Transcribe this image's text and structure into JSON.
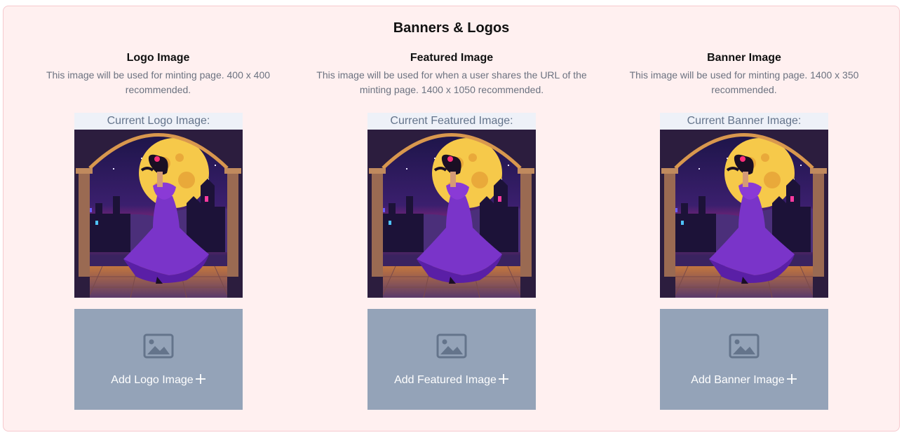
{
  "section": {
    "title": "Banners & Logos"
  },
  "columns": [
    {
      "title": "Logo Image",
      "description": "This image will be used for minting page. 400 x 400 recommended.",
      "current_label": "Current Logo Image:",
      "upload_label": "Add Logo Image"
    },
    {
      "title": "Featured Image",
      "description": "This image will be used for when a user shares the URL of the minting page. 1400 x 1050 recommended.",
      "current_label": "Current Featured Image:",
      "upload_label": "Add Featured Image"
    },
    {
      "title": "Banner Image",
      "description": "This image will be used for minting page. 1400 x 350 recommended.",
      "current_label": "Current Banner Image:",
      "upload_label": "Add Banner Image"
    }
  ],
  "icons": {
    "upload": "image-icon",
    "add": "plus-icon"
  },
  "colors": {
    "panel_bg": "#fff0f0",
    "panel_border": "#f6c9ce",
    "upload_bg": "#94a3b8",
    "label_bg": "#eef1f8",
    "muted_text": "#6b7280"
  }
}
